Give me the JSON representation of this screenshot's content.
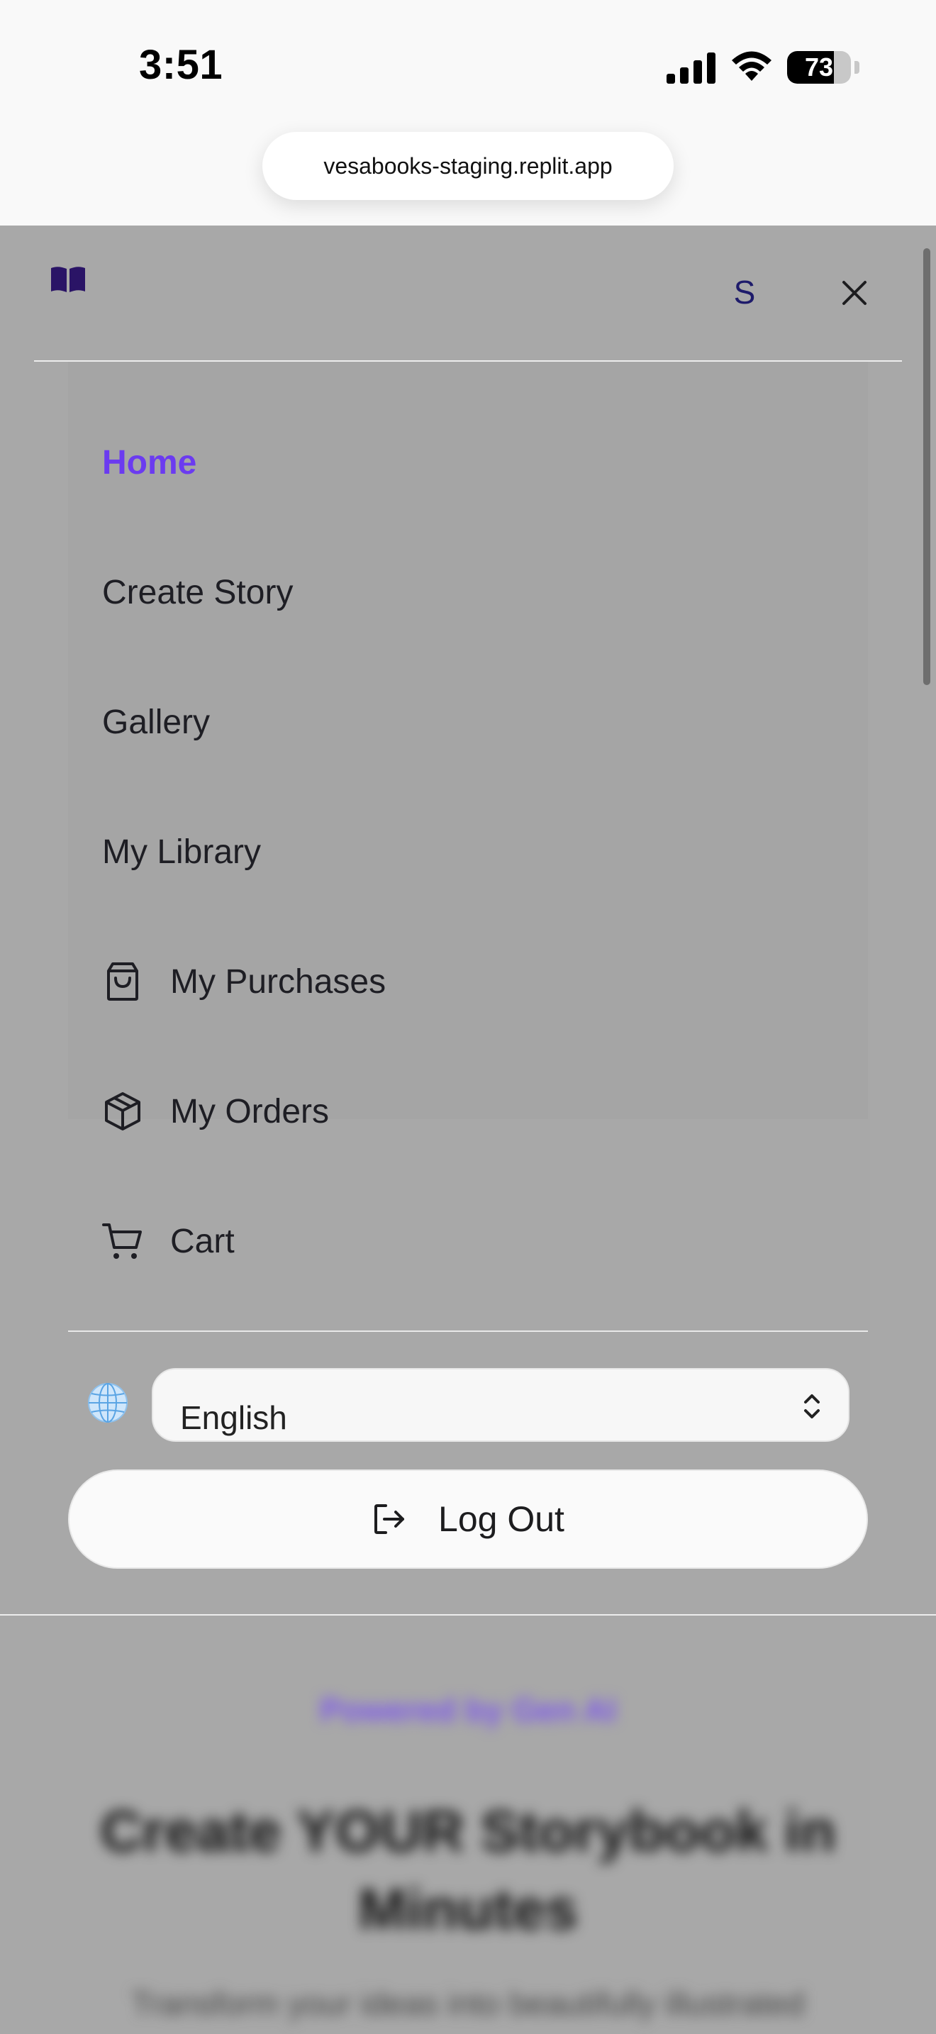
{
  "status_bar": {
    "time": "3:51",
    "battery_percent": "73",
    "battery_level": 0.73
  },
  "browser": {
    "url": "vesabooks-staging.replit.app"
  },
  "menu": {
    "avatar_initial": "S",
    "items": [
      {
        "label": "Home",
        "active": true,
        "icon": null
      },
      {
        "label": "Create Story",
        "active": false,
        "icon": null
      },
      {
        "label": "Gallery",
        "active": false,
        "icon": null
      },
      {
        "label": "My Library",
        "active": false,
        "icon": null
      },
      {
        "label": "My Purchases",
        "active": false,
        "icon": "shopping-bag-icon"
      },
      {
        "label": "My Orders",
        "active": false,
        "icon": "package-icon"
      },
      {
        "label": "Cart",
        "active": false,
        "icon": "cart-icon"
      }
    ],
    "language": {
      "selected": "English"
    },
    "logout_label": "Log Out"
  },
  "background_page": {
    "tagline": "Powered by Gen AI",
    "title": "Create YOUR Storybook in Minutes",
    "subtitle": "Transform your ideas into beautifully illustrated"
  },
  "colors": {
    "accent": "#6b3bf0",
    "logo": "#2a1466",
    "avatar_text": "#1e1b6b",
    "overlay": "#a8a8a8"
  }
}
